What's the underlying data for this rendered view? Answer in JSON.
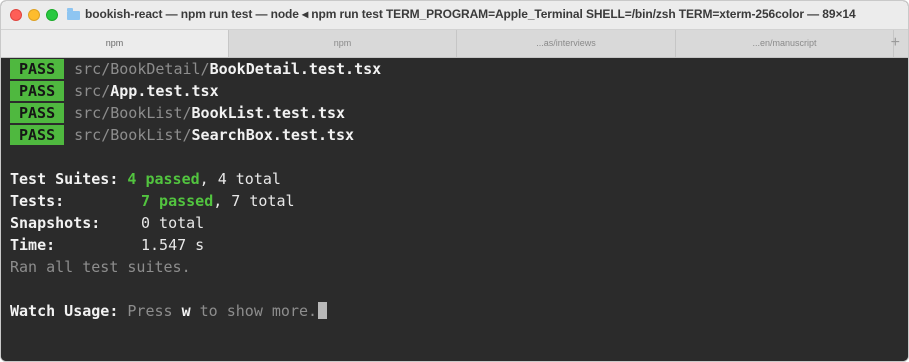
{
  "window": {
    "title": "bookish-react — npm run test — node ◂ npm run test TERM_PROGRAM=Apple_Terminal SHELL=/bin/zsh TERM=xterm-256color — 89×14"
  },
  "tabs": [
    {
      "label": "npm"
    },
    {
      "label": "npm"
    },
    {
      "label": "...as/interviews"
    },
    {
      "label": "...en/manuscript"
    }
  ],
  "tab_add_label": "+",
  "results": [
    {
      "badge": "PASS",
      "dir": "src/BookDetail/",
      "file": "BookDetail.test.tsx"
    },
    {
      "badge": "PASS",
      "dir": "src/",
      "file": "App.test.tsx"
    },
    {
      "badge": "PASS",
      "dir": "src/BookList/",
      "file": "BookList.test.tsx"
    },
    {
      "badge": "PASS",
      "dir": "src/BookList/",
      "file": "SearchBox.test.tsx"
    }
  ],
  "summary": {
    "suites_label": "Test Suites:",
    "suites_passed": "4 passed",
    "suites_total": ", 4 total",
    "tests_label": "Tests:",
    "tests_passed": "7 passed",
    "tests_total": ", 7 total",
    "snapshots_label": "Snapshots:",
    "snapshots_value": "0 total",
    "time_label": "Time:",
    "time_value": "1.547 s",
    "ran_all": "Ran all test suites."
  },
  "watch": {
    "label": "Watch Usage:",
    "press": "Press ",
    "key": "w",
    "rest": " to show more."
  },
  "colors": {
    "pass_badge": "#4fb83f",
    "passed_text": "#52c43f",
    "terminal_bg": "#2b2b2b"
  }
}
